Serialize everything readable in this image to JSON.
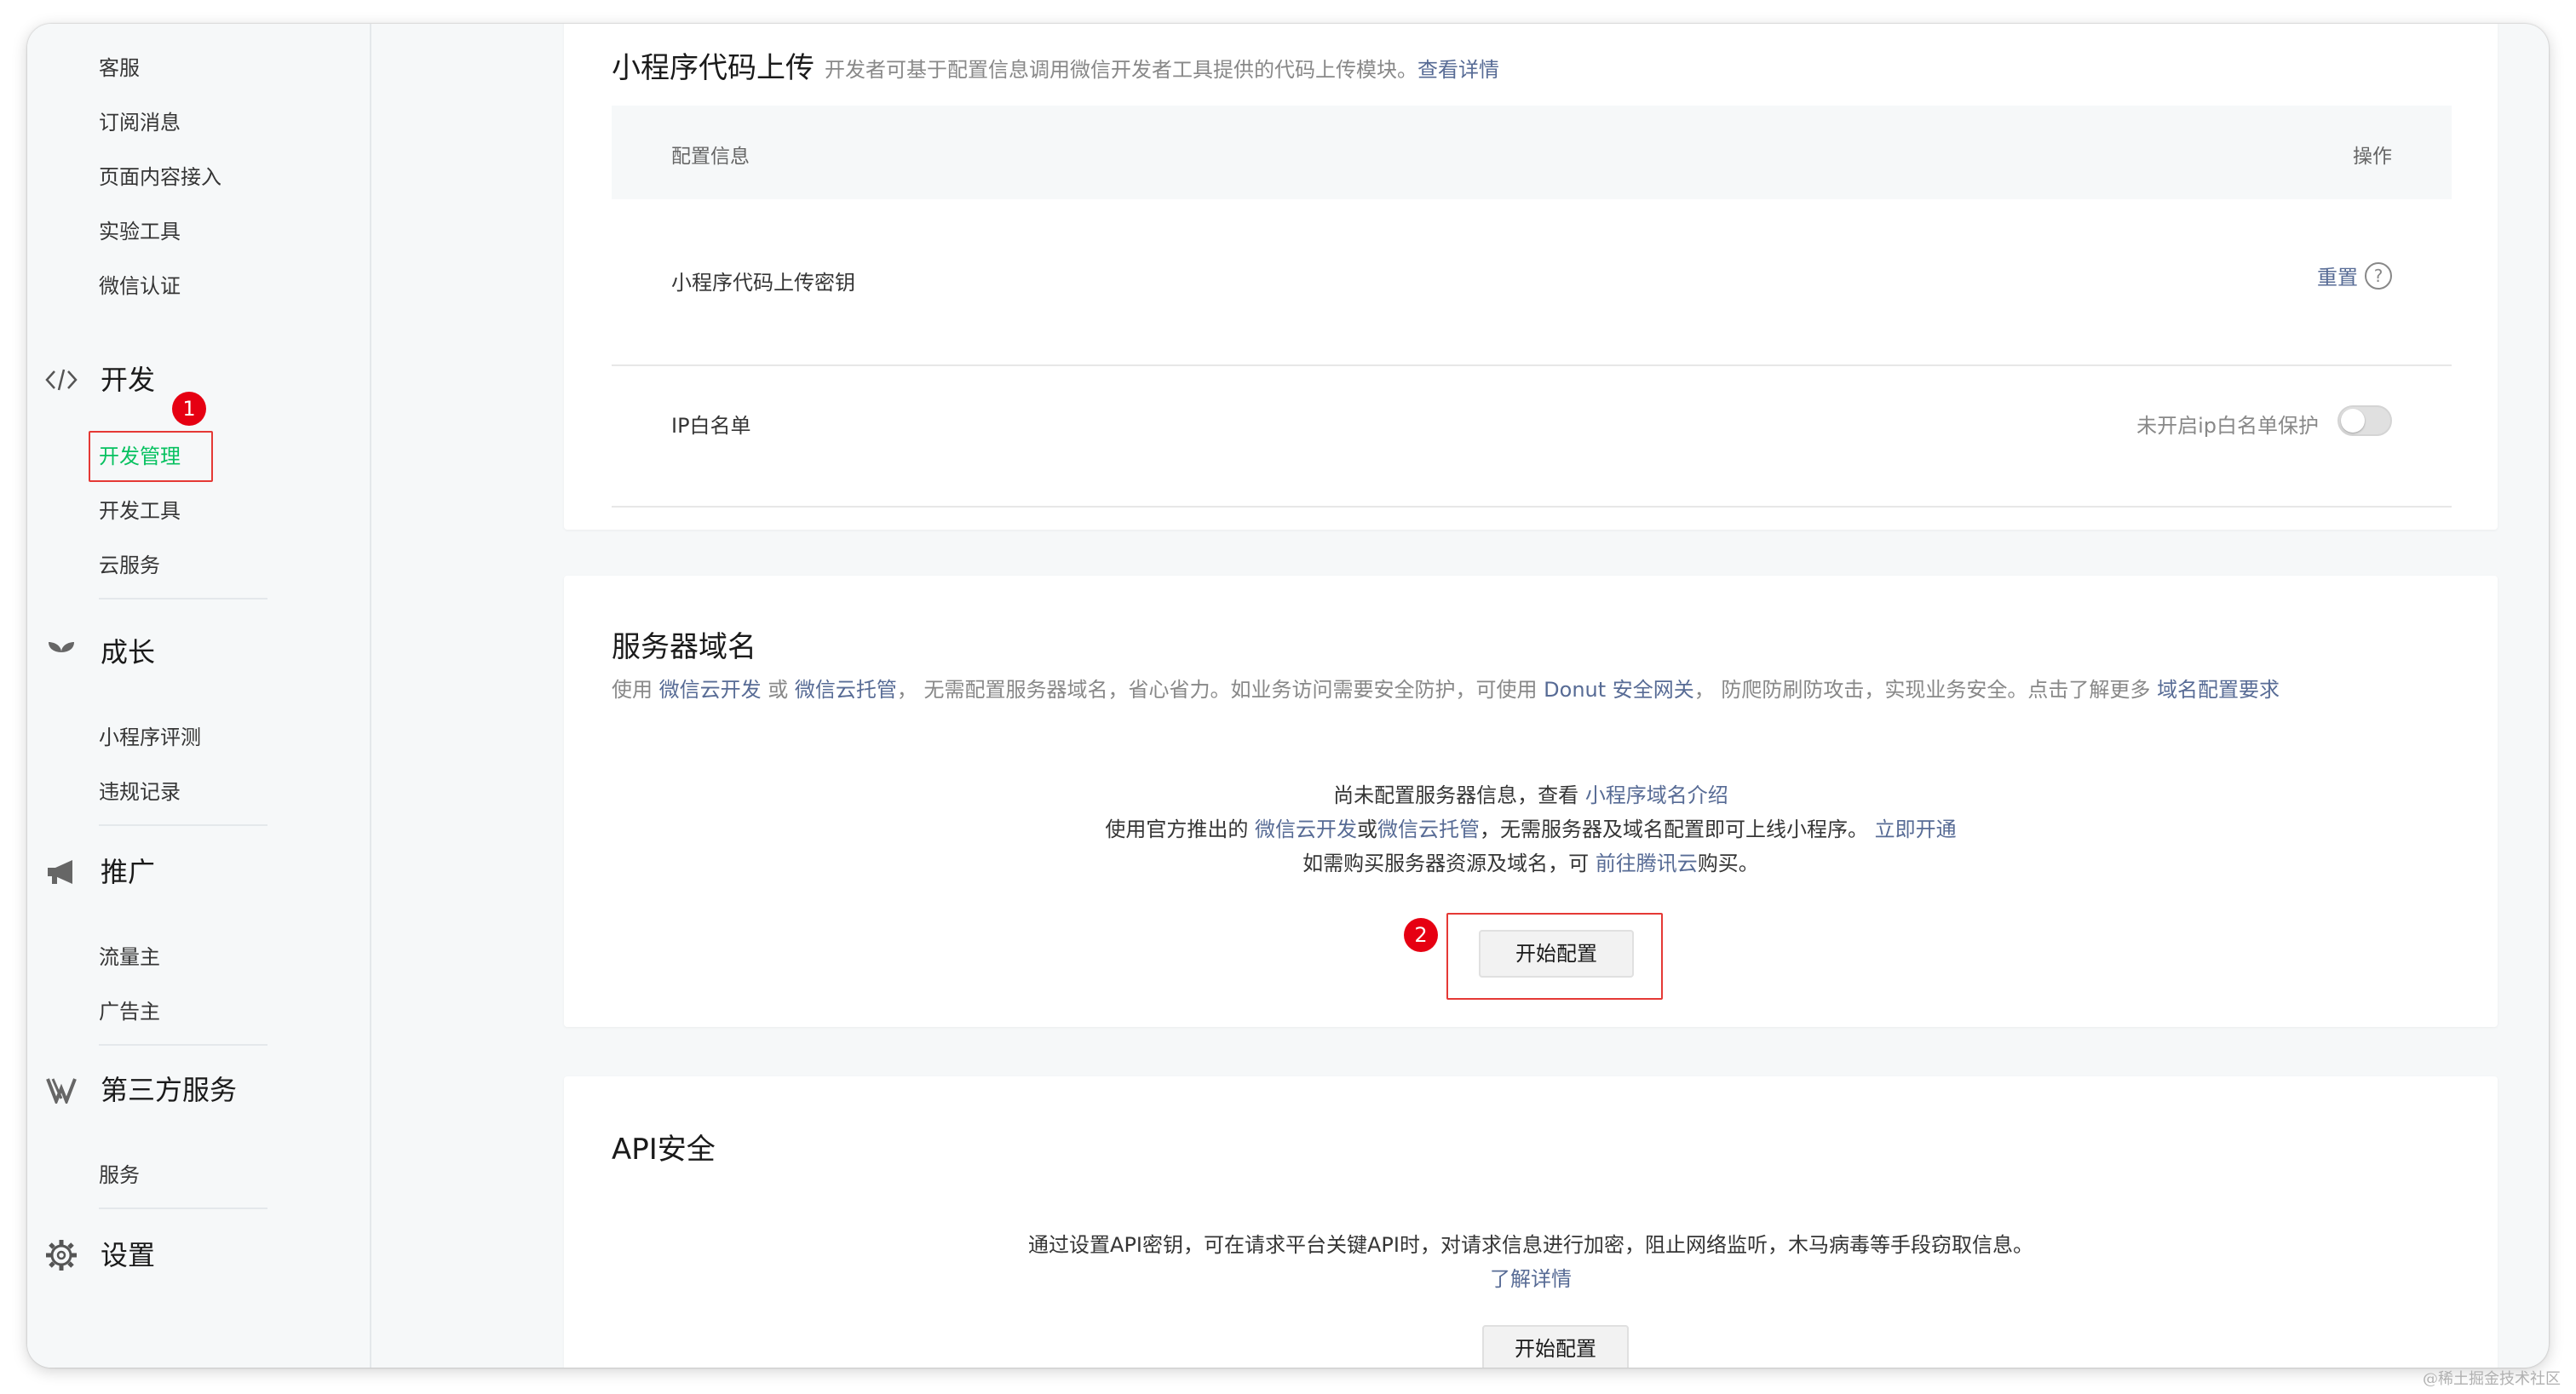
{
  "sidebar": {
    "top_items": [
      "客服",
      "订阅消息",
      "页面内容接入",
      "实验工具",
      "微信认证"
    ],
    "groups": [
      {
        "label": "开发",
        "icon": "code-icon",
        "items": [
          "开发管理",
          "开发工具",
          "云服务"
        ]
      },
      {
        "label": "成长",
        "icon": "sprout-icon",
        "items": [
          "小程序评测",
          "违规记录"
        ]
      },
      {
        "label": "推广",
        "icon": "megaphone-icon",
        "items": [
          "流量主",
          "广告主"
        ]
      },
      {
        "label": "第三方服务",
        "icon": "third-party-icon",
        "items": [
          "服务"
        ]
      },
      {
        "label": "设置",
        "icon": "gear-icon",
        "items": []
      }
    ],
    "active_item": "开发管理"
  },
  "annotations": {
    "badge1": "1",
    "badge2": "2"
  },
  "upload_card": {
    "title": "小程序代码上传",
    "desc": "开发者可基于配置信息调用微信开发者工具提供的代码上传模块。",
    "desc_link": "查看详情",
    "col_config": "配置信息",
    "col_action": "操作",
    "row1_label": "小程序代码上传密钥",
    "row1_action": "重置",
    "row2_label": "IP白名单",
    "row2_status": "未开启ip白名单保护"
  },
  "domain_card": {
    "title": "服务器域名",
    "desc_1": "使用 ",
    "link_1": "微信云开发",
    "desc_2": " 或 ",
    "link_2": "微信云托管",
    "desc_3": "， 无需配置服务器域名，省心省力。如业务访问需要安全防护，可使用 ",
    "link_3": "Donut 安全网关",
    "desc_4": "， 防爬防刷防攻击，实现业务安全。点击了解更多 ",
    "link_4": "域名配置要求",
    "line1_text": "尚未配置服务器信息，查看 ",
    "line1_link": "小程序域名介绍",
    "line2_text_a": "使用官方推出的 ",
    "line2_link_a": "微信云开发",
    "line2_text_b": "或",
    "line2_link_b": "微信云托管",
    "line2_text_c": "，无需服务器及域名配置即可上线小程序。 ",
    "line2_link_c": "立即开通",
    "line3_text_a": "如需购买服务器资源及域名，可 ",
    "line3_link": "前往腾讯云",
    "line3_text_b": "购买。",
    "button": "开始配置"
  },
  "api_card": {
    "title": "API安全",
    "desc": "通过设置API密钥，可在请求平台关键API时，对请求信息进行加密，阻止网络监听，木马病毒等手段窃取信息。",
    "link": "了解详情",
    "button": "开始配置"
  },
  "watermark": "@稀土掘金技术社区",
  "colors": {
    "accent": "#07c160",
    "link": "#576b95",
    "annotation_red": "#e53935"
  }
}
